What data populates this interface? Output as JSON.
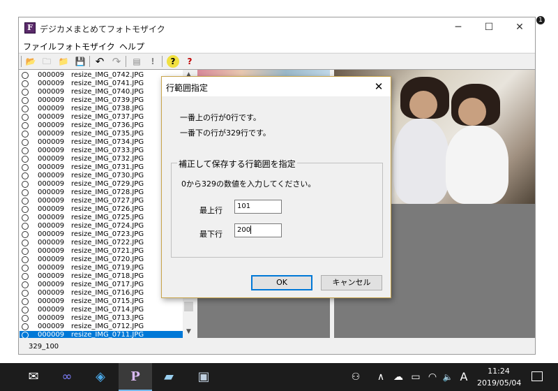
{
  "window": {
    "title": "デジカメまとめてフォトモザイク",
    "app_icon_letter": "F",
    "minimize_glyph": "─",
    "maximize_glyph": "☐",
    "close_glyph": "✕"
  },
  "menu": [
    "ファイル",
    "フォトモザイク",
    "ヘルプ"
  ],
  "toolbar": {
    "icons": [
      "open-folder-icon",
      "new-folder-icon",
      "folder-icon",
      "save-icon",
      "undo-icon",
      "redo-icon",
      "document-icon",
      "exclamation-icon",
      "help-icon",
      "context-help-icon"
    ],
    "glyphs": [
      "📂",
      "🗀",
      "📁",
      "💾",
      "↶",
      "↷",
      "▤",
      "!",
      "?",
      "?"
    ]
  },
  "file_list": [
    {
      "num": "000009",
      "name": "resize_IMG_0742.JPG"
    },
    {
      "num": "000009",
      "name": "resize_IMG_0741.JPG"
    },
    {
      "num": "000009",
      "name": "resize_IMG_0740.JPG"
    },
    {
      "num": "000009",
      "name": "resize_IMG_0739.JPG"
    },
    {
      "num": "000009",
      "name": "resize_IMG_0738.JPG"
    },
    {
      "num": "000009",
      "name": "resize_IMG_0737.JPG"
    },
    {
      "num": "000009",
      "name": "resize_IMG_0736.JPG"
    },
    {
      "num": "000009",
      "name": "resize_IMG_0735.JPG"
    },
    {
      "num": "000009",
      "name": "resize_IMG_0734.JPG"
    },
    {
      "num": "000009",
      "name": "resize_IMG_0733.JPG"
    },
    {
      "num": "000009",
      "name": "resize_IMG_0732.JPG"
    },
    {
      "num": "000009",
      "name": "resize_IMG_0731.JPG"
    },
    {
      "num": "000009",
      "name": "resize_IMG_0730.JPG"
    },
    {
      "num": "000009",
      "name": "resize_IMG_0729.JPG"
    },
    {
      "num": "000009",
      "name": "resize_IMG_0728.JPG"
    },
    {
      "num": "000009",
      "name": "resize_IMG_0727.JPG"
    },
    {
      "num": "000009",
      "name": "resize_IMG_0726.JPG"
    },
    {
      "num": "000009",
      "name": "resize_IMG_0725.JPG"
    },
    {
      "num": "000009",
      "name": "resize_IMG_0724.JPG"
    },
    {
      "num": "000009",
      "name": "resize_IMG_0723.JPG"
    },
    {
      "num": "000009",
      "name": "resize_IMG_0722.JPG"
    },
    {
      "num": "000009",
      "name": "resize_IMG_0721.JPG"
    },
    {
      "num": "000009",
      "name": "resize_IMG_0720.JPG"
    },
    {
      "num": "000009",
      "name": "resize_IMG_0719.JPG"
    },
    {
      "num": "000009",
      "name": "resize_IMG_0718.JPG"
    },
    {
      "num": "000009",
      "name": "resize_IMG_0717.JPG"
    },
    {
      "num": "000009",
      "name": "resize_IMG_0716.JPG"
    },
    {
      "num": "000009",
      "name": "resize_IMG_0715.JPG"
    },
    {
      "num": "000009",
      "name": "resize_IMG_0714.JPG"
    },
    {
      "num": "000009",
      "name": "resize_IMG_0713.JPG"
    },
    {
      "num": "000009",
      "name": "resize_IMG_0712.JPG"
    },
    {
      "num": "000009",
      "name": "resize_IMG_0711.JPG",
      "selected": true
    }
  ],
  "status": {
    "text": "329_100"
  },
  "dialog": {
    "title": "行範囲指定",
    "close_glyph": "✕",
    "line_top": "一番上の行が0行です。",
    "line_bottom": "一番下の行が329行です。",
    "group_title": "補正して保存する行範囲を指定",
    "instruction": "0から329の数値を入力してください。",
    "top_row_label": "最上行",
    "top_row_value": "101",
    "bottom_row_label": "最下行",
    "bottom_row_value": "200",
    "ok_label": "OK",
    "cancel_label": "キャンセル"
  },
  "taskbar": {
    "apps": [
      {
        "name": "mail-app-icon",
        "glyph": "✉"
      },
      {
        "name": "infinity-app-icon",
        "glyph": "∞"
      },
      {
        "name": "store-app-icon",
        "glyph": "◈"
      },
      {
        "name": "photomosaic-app-icon",
        "glyph": "P",
        "active": true
      },
      {
        "name": "notebook-app-icon",
        "glyph": "▰"
      },
      {
        "name": "image-viewer-app-icon",
        "glyph": "▣"
      }
    ],
    "tray": {
      "people_glyph": "⚇",
      "chevron_glyph": "∧",
      "cloud_glyph": "☁",
      "battery_glyph": "▭",
      "wifi_glyph": "◠",
      "volume_glyph": "🔈",
      "ime_label": "A",
      "time": "11:24",
      "date": "2019/05/04",
      "notification_count": "1"
    }
  }
}
